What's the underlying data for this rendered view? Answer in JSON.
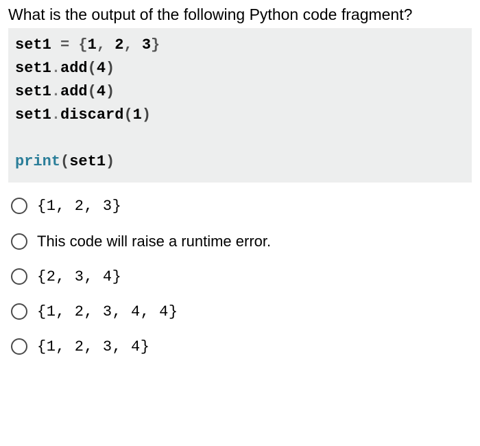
{
  "question": "What is the output of the following Python code fragment?",
  "code": {
    "line1_var": "set1",
    "line1_eq": " = ",
    "line1_open": "{",
    "line1_n1": "1",
    "line1_c1": ", ",
    "line1_n2": "2",
    "line1_c2": ", ",
    "line1_n3": "3",
    "line1_close": "}",
    "line2_var": "set1",
    "line2_dot": ".",
    "line2_method": "add",
    "line2_open": "(",
    "line2_arg": "4",
    "line2_close": ")",
    "line3_var": "set1",
    "line3_dot": ".",
    "line3_method": "add",
    "line3_open": "(",
    "line3_arg": "4",
    "line3_close": ")",
    "line4_var": "set1",
    "line4_dot": ".",
    "line4_method": "discard",
    "line4_open": "(",
    "line4_arg": "1",
    "line4_close": ")",
    "line5_print": "print",
    "line5_open": "(",
    "line5_arg": "set1",
    "line5_close": ")"
  },
  "options": [
    {
      "label": "{1, 2, 3}",
      "mono": true
    },
    {
      "label": "This code will raise a runtime error.",
      "mono": false
    },
    {
      "label": "{2, 3, 4}",
      "mono": true
    },
    {
      "label": "{1, 2, 3, 4, 4}",
      "mono": true
    },
    {
      "label": "{1, 2, 3, 4}",
      "mono": true
    }
  ]
}
